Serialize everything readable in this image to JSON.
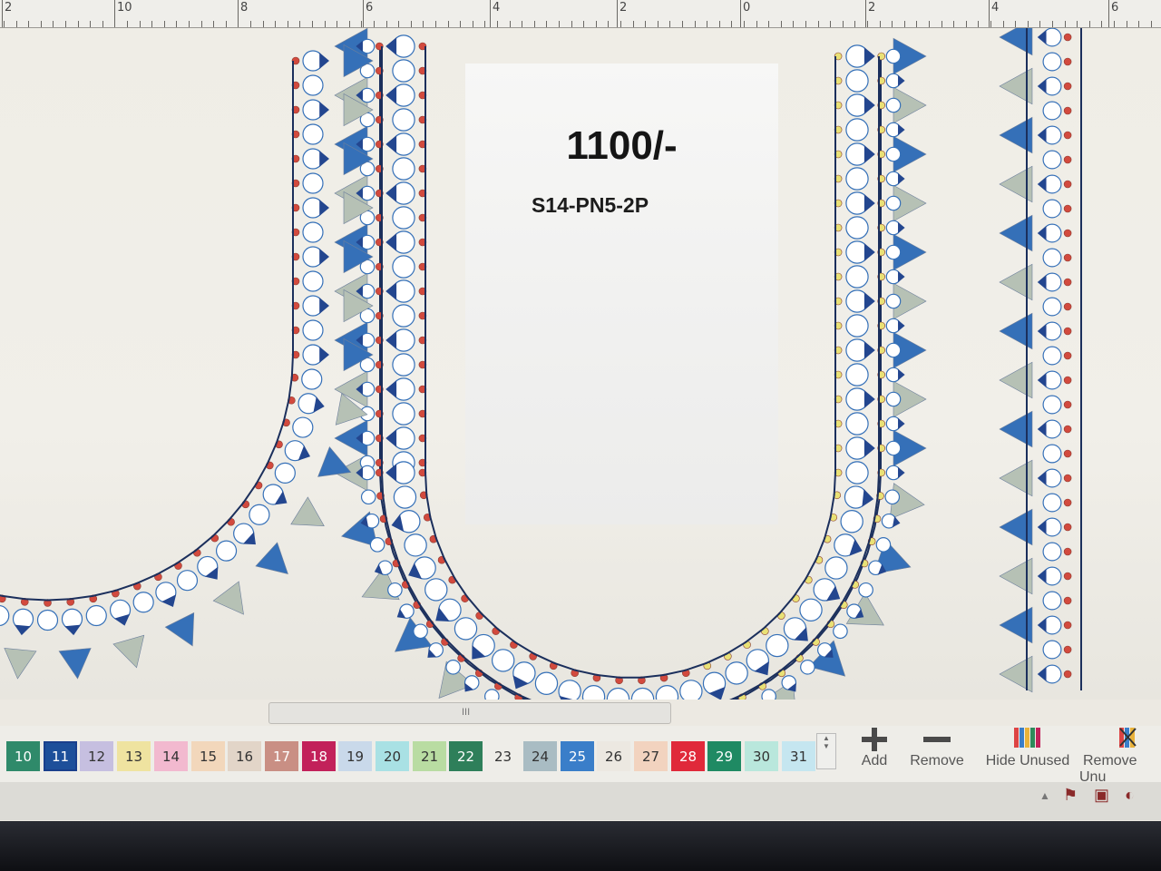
{
  "ruler": {
    "labels": [
      "2",
      "10",
      "8",
      "6",
      "4",
      "2",
      "0",
      "2",
      "4",
      "6"
    ]
  },
  "design": {
    "price": "1100/-",
    "code": "S14-PN5-2P",
    "colors": {
      "navy": "#23468f",
      "royal": "#3570b8",
      "sage": "#b6c1b5",
      "red": "#d24a3e",
      "yellow": "#e9e176",
      "outline": "#1b2f5c"
    }
  },
  "scrollbar": {
    "grip": "III"
  },
  "palette": {
    "swatches": [
      {
        "num": "10",
        "color": "#2f8a6a",
        "text_color": "#ffffff"
      },
      {
        "num": "11",
        "color": "#1d4f9a",
        "text_color": "#ffffff",
        "selected": true
      },
      {
        "num": "12",
        "color": "#c6bfe0",
        "text_color": "#333333"
      },
      {
        "num": "13",
        "color": "#efe3a0",
        "text_color": "#333333"
      },
      {
        "num": "14",
        "color": "#f2b9cf",
        "text_color": "#333333"
      },
      {
        "num": "15",
        "color": "#f2d7bb",
        "text_color": "#333333"
      },
      {
        "num": "16",
        "color": "#e2d5c8",
        "text_color": "#333333"
      },
      {
        "num": "17",
        "color": "#c98f84",
        "text_color": "#ffffff"
      },
      {
        "num": "18",
        "color": "#c2215a",
        "text_color": "#ffffff"
      },
      {
        "num": "19",
        "color": "#c9d9ea",
        "text_color": "#333333"
      },
      {
        "num": "20",
        "color": "#a9e1e4",
        "text_color": "#333333"
      },
      {
        "num": "21",
        "color": "#b9dca2",
        "text_color": "#333333"
      },
      {
        "num": "22",
        "color": "#2e7f5a",
        "text_color": "#ffffff"
      },
      {
        "num": "23",
        "color": "#eeede8",
        "text_color": "#333333"
      },
      {
        "num": "24",
        "color": "#a9bcc3",
        "text_color": "#333333"
      },
      {
        "num": "25",
        "color": "#3a7ec9",
        "text_color": "#ffffff"
      },
      {
        "num": "26",
        "color": "#ece8e1",
        "text_color": "#333333"
      },
      {
        "num": "27",
        "color": "#f2d3bf",
        "text_color": "#333333"
      },
      {
        "num": "28",
        "color": "#e0293a",
        "text_color": "#ffffff"
      },
      {
        "num": "29",
        "color": "#1f8a63",
        "text_color": "#ffffff"
      },
      {
        "num": "30",
        "color": "#b9e7dc",
        "text_color": "#333333"
      },
      {
        "num": "31",
        "color": "#c5e6f0",
        "text_color": "#333333"
      }
    ]
  },
  "tools": {
    "add": "Add",
    "remove": "Remove",
    "hide_unused": "Hide Unused",
    "remove_unused": "Remove Unu"
  }
}
